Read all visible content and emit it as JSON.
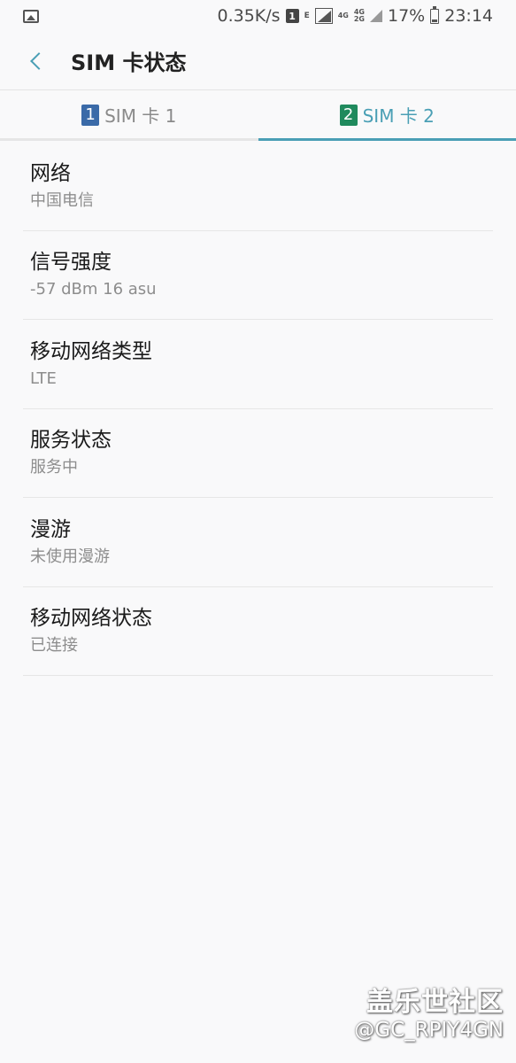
{
  "status_bar": {
    "speed": "0.35K/s",
    "sim_indicator": "1",
    "data_letter": "E",
    "net1": "4G",
    "net2a": "4G",
    "net2b": "2G",
    "battery": "17%",
    "time": "23:14",
    "icons": [
      "gallery-icon",
      "signal-icon",
      "battery-icon"
    ]
  },
  "header": {
    "title": "SIM 卡状态"
  },
  "tabs": [
    {
      "badge": "1",
      "label": "SIM 卡 1",
      "active": false
    },
    {
      "badge": "2",
      "label": "SIM 卡 2",
      "active": true
    }
  ],
  "rows": [
    {
      "title": "网络",
      "value": "中国电信"
    },
    {
      "title": "信号强度",
      "value": "-57 dBm 16 asu"
    },
    {
      "title": "移动网络类型",
      "value": "LTE"
    },
    {
      "title": "服务状态",
      "value": "服务中"
    },
    {
      "title": "漫游",
      "value": "未使用漫游"
    },
    {
      "title": "移动网络状态",
      "value": "已连接"
    }
  ],
  "watermark": {
    "line1": "盖乐世社区",
    "line2": "@GC_RPIY4GN"
  },
  "colors": {
    "accent": "#4a9fb5",
    "sim1": "#3a6aa8",
    "sim2": "#1f8a5d",
    "background": "#f9f9fa"
  }
}
